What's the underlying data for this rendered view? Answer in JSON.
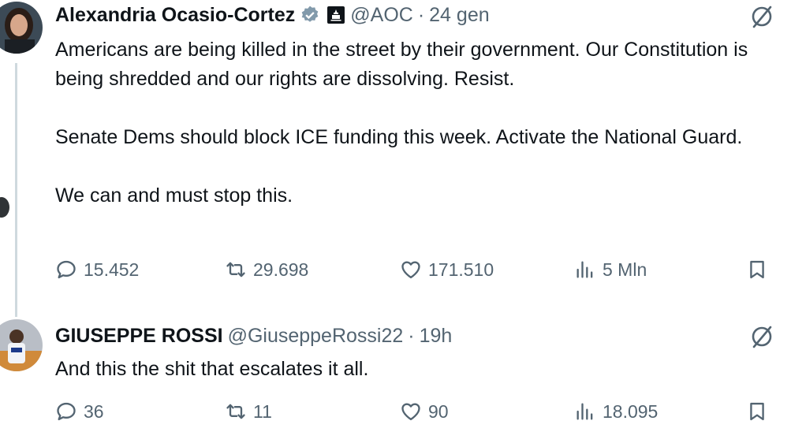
{
  "tweets": [
    {
      "author": {
        "name": "Alexandria Ocasio-Cortez",
        "handle": "@AOC",
        "time": "24 gen"
      },
      "text": [
        "Americans are being killed in the street by their government. Our Constitution is being shredded and our rights are dissolving. Resist.",
        "Senate Dems should block ICE funding this week. Activate the National Guard.",
        "We can and must stop this."
      ],
      "stats": {
        "replies": "15.452",
        "reposts": "29.698",
        "likes": "171.510",
        "views": "5 Mln"
      }
    },
    {
      "author": {
        "name": "GIUSEPPE ROSSI",
        "handle": "@GiuseppeRossi22",
        "time": "19h"
      },
      "text": [
        "And this the shit that escalates it all."
      ],
      "stats": {
        "replies": "36",
        "reposts": "11",
        "likes": "90",
        "views": "18.095"
      }
    }
  ],
  "separator": "·",
  "icons": [
    "verified-badge-icon",
    "government-badge-icon",
    "grok-icon",
    "reply-icon",
    "repost-icon",
    "like-icon",
    "views-icon",
    "bookmark-icon"
  ],
  "colors": {
    "text": "#0f1419",
    "secondary": "#536471",
    "line": "#cfd9de"
  }
}
